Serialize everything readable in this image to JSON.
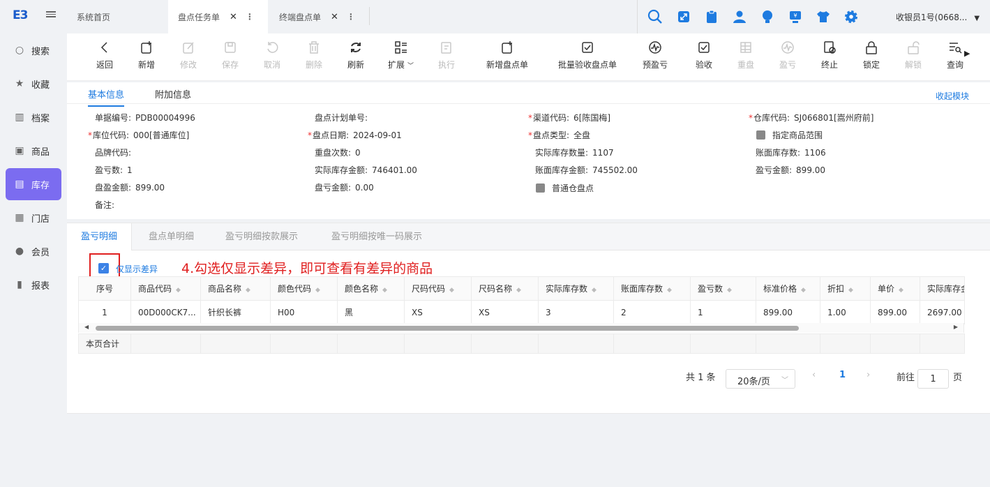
{
  "sidebar": {
    "items": [
      {
        "label": "搜索",
        "icon": "search-icon"
      },
      {
        "label": "收藏",
        "icon": "star-icon"
      },
      {
        "label": "档案",
        "icon": "books-icon"
      },
      {
        "label": "商品",
        "icon": "goods-icon"
      },
      {
        "label": "库存",
        "icon": "inventory-icon",
        "active": true
      },
      {
        "label": "门店",
        "icon": "store-icon"
      },
      {
        "label": "会员",
        "icon": "member-icon"
      },
      {
        "label": "报表",
        "icon": "report-icon"
      }
    ]
  },
  "tabs": [
    {
      "label": "系统首页"
    },
    {
      "label": "盘点任务单",
      "active": true
    },
    {
      "label": "终端盘点单"
    }
  ],
  "header": {
    "user": "收银员1号(0668..."
  },
  "toolbar": {
    "buttons": [
      {
        "label": "返回"
      },
      {
        "label": "新增"
      },
      {
        "label": "修改"
      },
      {
        "label": "保存"
      },
      {
        "label": "取消"
      },
      {
        "label": "删除"
      },
      {
        "label": "刷新"
      },
      {
        "label": "扩展"
      },
      {
        "label": "执行"
      },
      {
        "label": "新增盘点单"
      },
      {
        "label": "批量验收盘点单"
      },
      {
        "label": "预盈亏"
      },
      {
        "label": "验收"
      },
      {
        "label": "重盘"
      },
      {
        "label": "盈亏"
      },
      {
        "label": "终止"
      },
      {
        "label": "锁定"
      },
      {
        "label": "解锁"
      },
      {
        "label": "查询"
      }
    ]
  },
  "info": {
    "tabs": [
      "基本信息",
      "附加信息"
    ],
    "collapse": "收起模块",
    "fields": [
      {
        "label": "单据编号:",
        "value": "PDB00004996"
      },
      {
        "label": "盘点计划单号:",
        "value": ""
      },
      {
        "label": "渠道代码:",
        "value": "6[陈国梅]",
        "req": "*"
      },
      {
        "label": "仓库代码:",
        "value": "SJ066801[嵩州府前]",
        "req": "*"
      },
      {
        "label": "库位代码:",
        "value": "000[普通库位]",
        "req": "*"
      },
      {
        "label": "盘点日期:",
        "value": "2024-09-01",
        "req": "*"
      },
      {
        "label": "盘点类型:",
        "value": "全盘",
        "req": "*"
      },
      {
        "label": "指定商品范围",
        "value": ""
      },
      {
        "label": "品牌代码:",
        "value": ""
      },
      {
        "label": "重盘次数:",
        "value": "0"
      },
      {
        "label": "实际库存数量:",
        "value": "1107"
      },
      {
        "label": "账面库存数:",
        "value": "1106"
      },
      {
        "label": "盈亏数:",
        "value": "1"
      },
      {
        "label": "实际库存金额:",
        "value": "746401.00"
      },
      {
        "label": "账面库存金额:",
        "value": "745502.00"
      },
      {
        "label": "盈亏金额:",
        "value": "899.00"
      },
      {
        "label": "盘盈金额:",
        "value": "899.00"
      },
      {
        "label": "盘亏金额:",
        "value": "0.00"
      },
      {
        "label": "普通仓盘点",
        "value": ""
      },
      {
        "label": "备注:",
        "value": ""
      }
    ]
  },
  "detail": {
    "tabs": [
      "盈亏明细",
      "盘点单明细",
      "盈亏明细按款展示",
      "盈亏明细按唯一码展示"
    ],
    "checkbox_label": "仅显示差异",
    "annotation": "4.勾选仅显示差异，即可查看有差异的商品",
    "columns": [
      "序号",
      "商品代码",
      "商品名称",
      "颜色代码",
      "颜色名称",
      "尺码代码",
      "尺码名称",
      "实际库存数",
      "账面库存数",
      "盈亏数",
      "标准价格",
      "折扣",
      "单价",
      "实际库存金"
    ],
    "rows": [
      [
        "1",
        "00D000CK7...",
        "针织长裤",
        "H00",
        "黑",
        "XS",
        "XS",
        "3",
        "2",
        "1",
        "899.00",
        "1.00",
        "899.00",
        "2697.00"
      ]
    ],
    "summary_label": "本页合计"
  },
  "pager": {
    "total": "共 1 条",
    "page_size": "20条/页",
    "current": "1",
    "goto_label": "前往",
    "goto_value": "1",
    "page_suffix": "页"
  }
}
